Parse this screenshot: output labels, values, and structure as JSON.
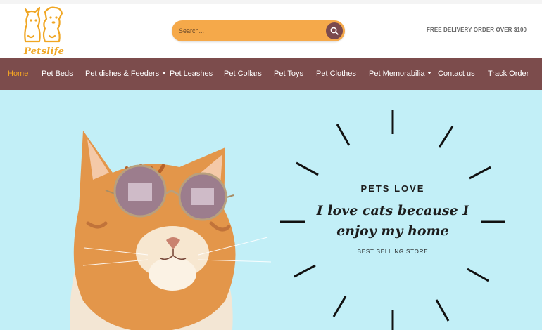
{
  "brand": {
    "logo_text": "Petslife",
    "accent": "#f0a623"
  },
  "search": {
    "placeholder": "Search...",
    "icon": "search-icon"
  },
  "promo": {
    "text": "FREE DELIVERY ORDER OVER $100"
  },
  "nav": {
    "background": "#7c4c4c",
    "active_color": "#f5a623",
    "items": [
      {
        "label": "Home",
        "active": true,
        "has_dropdown": false
      },
      {
        "label": "Pet Beds",
        "active": false,
        "has_dropdown": false
      },
      {
        "label": "Pet dishes & Feeders",
        "active": false,
        "has_dropdown": true
      },
      {
        "label": "Pet Leashes",
        "active": false,
        "has_dropdown": false
      },
      {
        "label": "Pet Collars",
        "active": false,
        "has_dropdown": false
      },
      {
        "label": "Pet Toys",
        "active": false,
        "has_dropdown": false
      },
      {
        "label": "Pet Clothes",
        "active": false,
        "has_dropdown": false
      },
      {
        "label": "Pet Memorabilia",
        "active": false,
        "has_dropdown": true
      },
      {
        "label": "Contact us",
        "active": false,
        "has_dropdown": false
      },
      {
        "label": "Track Order",
        "active": false,
        "has_dropdown": false
      }
    ]
  },
  "hero": {
    "background": "#c2eff7",
    "eyebrow": "PETS LOVE",
    "headline_line1": "I love cats because I",
    "headline_line2": "enjoy my home",
    "subline": "BEST SELLING STORE"
  }
}
